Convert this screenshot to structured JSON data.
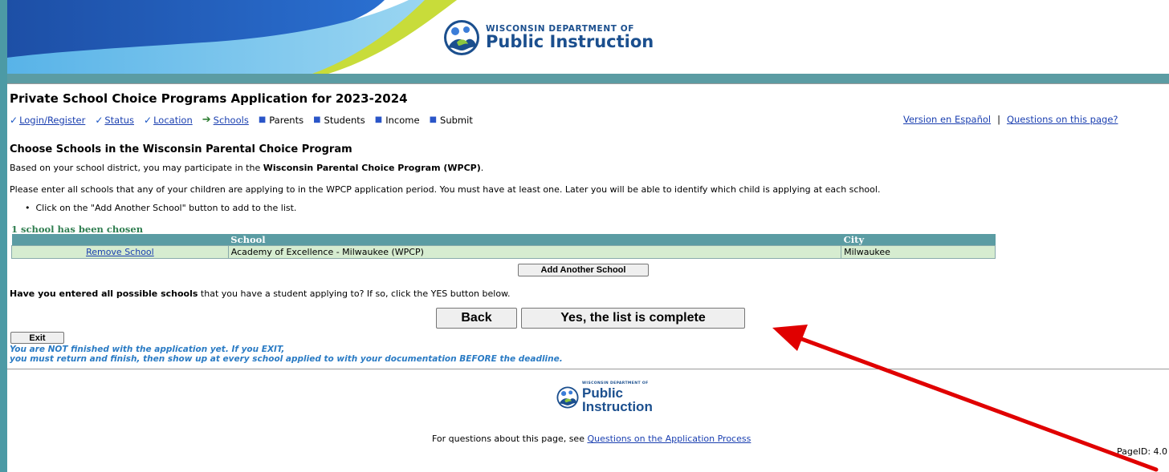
{
  "header": {
    "logo_small": "WISCONSIN DEPARTMENT OF",
    "logo_big": "Public Instruction"
  },
  "page_title": "Private School Choice Programs Application for 2023-2024",
  "steps": [
    {
      "label": "Login/Register",
      "state": "done"
    },
    {
      "label": "Status",
      "state": "done"
    },
    {
      "label": "Location",
      "state": "done"
    },
    {
      "label": "Schools",
      "state": "current"
    },
    {
      "label": "Parents",
      "state": "pending"
    },
    {
      "label": "Students",
      "state": "pending"
    },
    {
      "label": "Income",
      "state": "pending"
    },
    {
      "label": "Submit",
      "state": "pending"
    }
  ],
  "top_links": {
    "spanish": "Version en Español",
    "separator": "|",
    "questions": "Questions on this page?"
  },
  "section_heading": "Choose Schools in the Wisconsin Parental Choice Program",
  "intro": {
    "prefix": "Based on your school district, you may participate in the ",
    "program": "Wisconsin Parental Choice Program (WPCP)",
    "suffix": "."
  },
  "instructions": "Please enter all schools that any of your children are applying to in the WPCP application period. You must have at least one. Later you will be able to identify which child is applying at each school.",
  "bullet": "Click on the \"Add Another School\" button to add to the list.",
  "count_label": "1 school has been chosen",
  "table": {
    "headers": [
      "",
      "School",
      "City"
    ],
    "rows": [
      {
        "action": "Remove School",
        "school": "Academy of Excellence - Milwaukee (WPCP)",
        "city": "Milwaukee"
      }
    ]
  },
  "buttons": {
    "add": "Add Another School",
    "back": "Back",
    "yes": "Yes, the list is complete",
    "exit": "Exit"
  },
  "question": {
    "bold": "Have you entered all possible schools",
    "rest": " that you have a student applying to? If so, click the YES button below."
  },
  "warning": {
    "line1": "You are NOT finished with the application yet. If you EXIT,",
    "line2": "you must return and finish, then show up at every school applied to with your documentation BEFORE the deadline."
  },
  "footer": {
    "logo_small": "WISCONSIN DEPARTMENT OF",
    "logo_line1": "Public",
    "logo_line2": "Instruction",
    "note_prefix": "For questions about this page, see ",
    "note_link": "Questions on the Application Process",
    "page_id": "PageID: 4.0"
  },
  "colors": {
    "teal": "#5b9ca3",
    "link": "#1a3fb0",
    "warning": "#2a7bc4",
    "annotation": "#e00000"
  }
}
